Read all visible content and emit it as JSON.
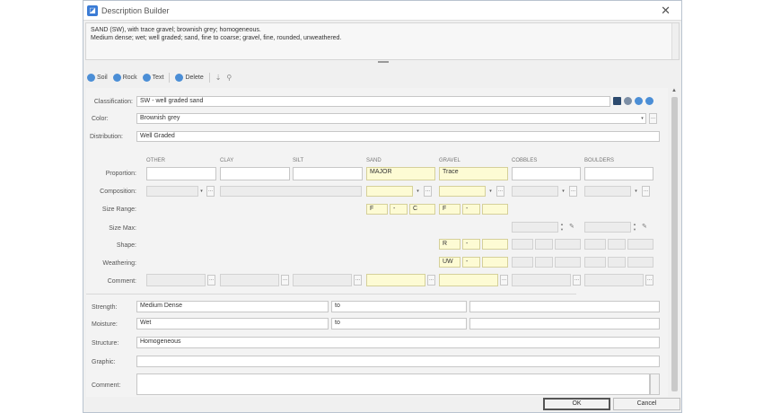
{
  "window": {
    "title": "Description Builder",
    "close_glyph": "✕"
  },
  "description": {
    "line1": "SAND (SW), with trace gravel; brownish grey; homogeneous.",
    "line2": "Medium dense; wet; well graded; sand, fine to coarse; gravel, fine, rounded, unweathered."
  },
  "toolbar": {
    "soil": "Soil",
    "rock": "Rock",
    "text": "Text",
    "delete": "Delete",
    "down": "⇣",
    "pin": "⚲"
  },
  "labels": {
    "classification": "Classification:",
    "color": "Color:",
    "distribution": "Distribution:",
    "proportion": "Proportion:",
    "composition": "Composition:",
    "size_range": "Size Range:",
    "size_max": "Size Max:",
    "shape": "Shape:",
    "weathering": "Weathering:",
    "comment": "Comment:",
    "strength": "Strength:",
    "moisture": "Moisture:",
    "structure": "Structure:",
    "graphic": "Graphic:",
    "comment2": "Comment:"
  },
  "values": {
    "classification": "SW - well graded sand",
    "color": "Brownish grey",
    "distribution": "Well Graded",
    "strength_from": "Medium Dense",
    "strength_to": "to",
    "moisture_from": "Wet",
    "moisture_to": "to",
    "structure": "Homogeneous",
    "graphic": "",
    "comment": ""
  },
  "columns": [
    "OTHER",
    "CLAY",
    "SILT",
    "SAND",
    "GRAVEL",
    "COBBLES",
    "BOULDERS"
  ],
  "sand": {
    "proportion": "MAJOR",
    "size_from": "F",
    "size_dash": "-",
    "size_to": "C"
  },
  "gravel": {
    "proportion": "Trace",
    "size_from": "F",
    "size_dash": "-",
    "shape": "R",
    "shape_dash": "-",
    "weathering": "UW",
    "weathering_dash": "-"
  },
  "symbols": {
    "dots": "...",
    "dropdown": "▾",
    "spin_up": "▲",
    "spin_down": "▼",
    "scroll_up": "▲",
    "eraser": "✎"
  },
  "footer": {
    "ok": "OK",
    "cancel": "Cancel"
  }
}
